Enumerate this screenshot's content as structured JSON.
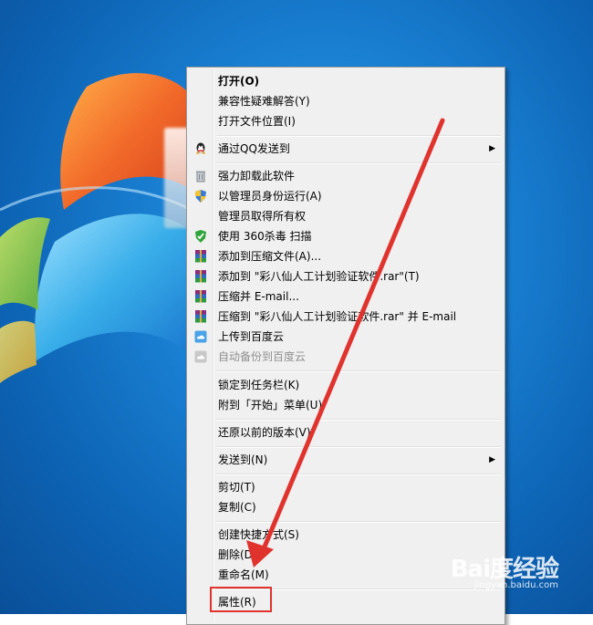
{
  "menu": {
    "items": [
      {
        "label": "打开(O)",
        "bold": true,
        "icon": ""
      },
      {
        "label": "兼容性疑难解答(Y)",
        "icon": ""
      },
      {
        "label": "打开文件位置(I)",
        "icon": ""
      },
      {
        "label": "通过QQ发送到",
        "icon": "qq-icon",
        "submenu": true
      },
      {
        "label": "强力卸载此软件",
        "icon": "trash-icon"
      },
      {
        "label": "以管理员身份运行(A)",
        "icon": "uac-shield-icon"
      },
      {
        "label": "管理员取得所有权",
        "icon": ""
      },
      {
        "label": "使用 360杀毒 扫描",
        "icon": "360-shield-icon"
      },
      {
        "label": "添加到压缩文件(A)...",
        "icon": "winrar-icon"
      },
      {
        "label": "添加到 \"彩八仙人工计划验证软件.rar\"(T)",
        "icon": "winrar-icon"
      },
      {
        "label": "压缩并 E-mail...",
        "icon": "winrar-icon"
      },
      {
        "label": "压缩到 \"彩八仙人工计划验证软件.rar\" 并 E-mail",
        "icon": "winrar-icon"
      },
      {
        "label": "上传到百度云",
        "icon": "baidu-cloud-icon"
      },
      {
        "label": "自动备份到百度云",
        "icon": "baidu-cloud-icon",
        "disabled": true
      },
      {
        "label": "锁定到任务栏(K)",
        "icon": ""
      },
      {
        "label": "附到「开始」菜单(U)",
        "icon": ""
      },
      {
        "label": "还原以前的版本(V)",
        "icon": ""
      },
      {
        "label": "发送到(N)",
        "icon": "",
        "submenu": true
      },
      {
        "label": "剪切(T)",
        "icon": ""
      },
      {
        "label": "复制(C)",
        "icon": ""
      },
      {
        "label": "创建快捷方式(S)",
        "icon": ""
      },
      {
        "label": "删除(D)",
        "icon": ""
      },
      {
        "label": "重命名(M)",
        "icon": ""
      },
      {
        "label": "属性(R)",
        "icon": ""
      }
    ],
    "submenu_arrow": "▶"
  },
  "watermark": {
    "main": "Bai度经验",
    "sub": "jingyan.baidu.com"
  },
  "colors": {
    "highlight": "#e0332e",
    "arrow": "#e0332e"
  }
}
